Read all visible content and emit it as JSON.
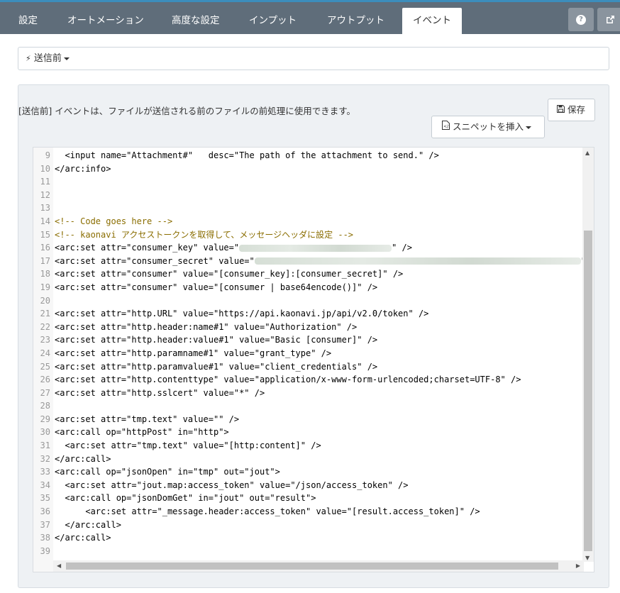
{
  "tabs": [
    {
      "label": "設定"
    },
    {
      "label": "オートメーション"
    },
    {
      "label": "高度な設定"
    },
    {
      "label": "インプット"
    },
    {
      "label": "アウトプット"
    },
    {
      "label": "イベント"
    }
  ],
  "active_tab": "イベント",
  "header_icons": {
    "help": "help-icon",
    "external": "external-link-icon"
  },
  "event_selector": {
    "icon": "⚡",
    "label": "送信前"
  },
  "description": "[送信前] イベントは、ファイルが送信される前のファイルの前処理に使用できます。",
  "save_button": {
    "icon": "🖫",
    "label": "保存"
  },
  "snippet_button": {
    "icon": "🗎",
    "label": "スニペットを挿入"
  },
  "code": [
    {
      "n": "9",
      "text": "  <input name=\"Attachment#\"   desc=\"The path of the attachment to send.\" />"
    },
    {
      "n": "10",
      "text": "</arc:info>"
    },
    {
      "n": "11",
      "text": ""
    },
    {
      "n": "12",
      "text": ""
    },
    {
      "n": "13",
      "text": ""
    },
    {
      "n": "14",
      "text": "<!-- Code goes here -->",
      "comment": true
    },
    {
      "n": "15",
      "text": "<!-- kaonavi アクセストークンを取得して、メッセージヘッダに設定 -->",
      "comment": true
    },
    {
      "n": "16",
      "text": "<arc:set attr=\"consumer_key\" value=\"",
      "tail": "\" />"
    },
    {
      "n": "17",
      "text": "<arc:set attr=\"consumer_secret\" value=\"",
      "tail": "\" /"
    },
    {
      "n": "18",
      "text": "<arc:set attr=\"consumer\" value=\"[consumer_key]:[consumer_secret]\" />"
    },
    {
      "n": "19",
      "text": "<arc:set attr=\"consumer\" value=\"[consumer | base64encode()]\" />"
    },
    {
      "n": "20",
      "text": ""
    },
    {
      "n": "21",
      "text": "<arc:set attr=\"http.URL\" value=\"https://api.kaonavi.jp/api/v2.0/token\" />"
    },
    {
      "n": "22",
      "text": "<arc:set attr=\"http.header:name#1\" value=\"Authorization\" />"
    },
    {
      "n": "23",
      "text": "<arc:set attr=\"http.header:value#1\" value=\"Basic [consumer]\" />"
    },
    {
      "n": "24",
      "text": "<arc:set attr=\"http.paramname#1\" value=\"grant_type\" />"
    },
    {
      "n": "25",
      "text": "<arc:set attr=\"http.paramvalue#1\" value=\"client_credentials\" />"
    },
    {
      "n": "26",
      "text": "<arc:set attr=\"http.contenttype\" value=\"application/x-www-form-urlencoded;charset=UTF-8\" />"
    },
    {
      "n": "27",
      "text": "<arc:set attr=\"http.sslcert\" value=\"*\" />"
    },
    {
      "n": "28",
      "text": ""
    },
    {
      "n": "29",
      "text": "<arc:set attr=\"tmp.text\" value=\"\" />"
    },
    {
      "n": "30",
      "text": "<arc:call op=\"httpPost\" in=\"http\">"
    },
    {
      "n": "31",
      "text": "  <arc:set attr=\"tmp.text\" value=\"[http:content]\" />"
    },
    {
      "n": "32",
      "text": "</arc:call>"
    },
    {
      "n": "33",
      "text": "<arc:call op=\"jsonOpen\" in=\"tmp\" out=\"jout\">"
    },
    {
      "n": "34",
      "text": "  <arc:set attr=\"jout.map:access_token\" value=\"/json/access_token\" />"
    },
    {
      "n": "35",
      "text": "  <arc:call op=\"jsonDomGet\" in=\"jout\" out=\"result\">"
    },
    {
      "n": "36",
      "text": "      <arc:set attr=\"_message.header:access_token\" value=\"[result.access_token]\" />"
    },
    {
      "n": "37",
      "text": "  </arc:call>"
    },
    {
      "n": "38",
      "text": "</arc:call>"
    },
    {
      "n": "39",
      "text": ""
    }
  ]
}
